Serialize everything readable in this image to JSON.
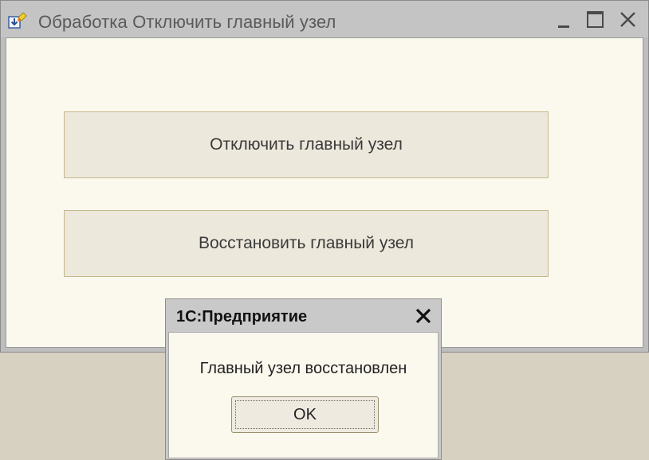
{
  "window": {
    "title": "Обработка  Отключить главный узел",
    "icon": "processing-icon",
    "controls": [
      "minimize-icon",
      "maximize-icon",
      "close-icon"
    ]
  },
  "form": {
    "disable_button_label": "Отключить главный узел",
    "restore_button_label": "Восстановить главный узел"
  },
  "dialog": {
    "title": "1С:Предприятие",
    "message": "Главный узел восстановлен",
    "ok_label": "OK",
    "close_icon": "close-icon"
  },
  "colors": {
    "window_background": "#fbf8ed",
    "button_background": "#ede8dc",
    "titlebar": "#c4c4c4"
  }
}
